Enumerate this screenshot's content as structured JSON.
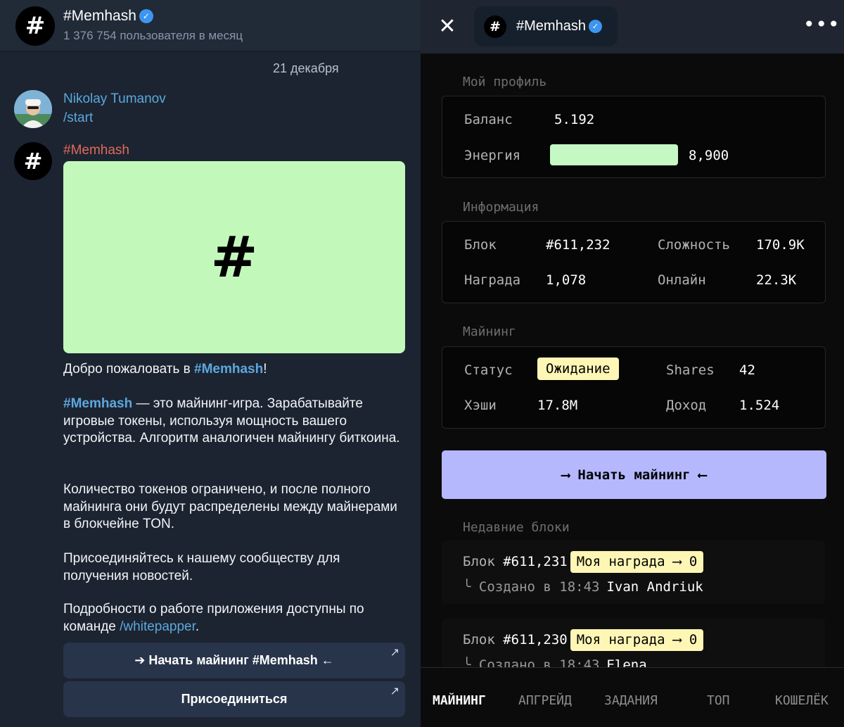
{
  "chat": {
    "title": "#Memhash",
    "subtitle": "1 376 754 пользователя в месяц",
    "date": "21 декабря",
    "user_message": {
      "name": "Nikolay Tumanov",
      "text": "/start"
    },
    "bot_message": {
      "name": "#Memhash",
      "image_glyph": "#",
      "p1_a": "Добро пожаловать в ",
      "p1_link": "#Memhash",
      "p1_b": "!",
      "p2_link": "#Memhash",
      "p2_text": " — это майнинг-игра. Зарабатывайте игровые токены, используя мощность вашего устройства. Алгоритм аналогичен майнингу биткоина.",
      "p3_text": "Количество токенов ограничено, и после полного майнинга они будут распределены между майнерами в блокчейне TON.",
      "p4_text": "Присоединяйтесь к нашему сообществу для получения новостей.",
      "p5_text": "Подробности о работе приложения доступны по команде ",
      "p5_link": "/whitepapper",
      "p5_end": "."
    },
    "buttons": {
      "start": "➔ Начать майнинг #Memhash ←",
      "join": "Присоединиться",
      "external_glyph": "↗"
    }
  },
  "app": {
    "title": "#Memhash",
    "close_glyph": "✕",
    "more_glyph": "•••",
    "verified_glyph": "✓",
    "profile": {
      "section": "Мой профиль",
      "balance_label": "Баланс",
      "balance_value": "5.192",
      "energy_label": "Энергия",
      "energy_value": "8,900",
      "energy_fraction": 1.0
    },
    "info": {
      "section": "Информация",
      "block_label": "Блок",
      "block_value": "#611,232",
      "difficulty_label": "Сложность",
      "difficulty_value": "170.9K",
      "reward_label": "Награда",
      "reward_value": "1,078",
      "online_label": "Онлайн",
      "online_value": "22.3K"
    },
    "mining": {
      "section": "Майнинг",
      "status_label": "Статус",
      "status_value": "Ожидание",
      "shares_label": "Shares",
      "shares_value": "42",
      "hashes_label": "Хэши",
      "hashes_value": "17.8M",
      "income_label": "Доход",
      "income_value": "1.524"
    },
    "start_button": "⟶ Начать майнинг ⟵",
    "recent": {
      "section": "Недавние блоки",
      "blocks": [
        {
          "label": "Блок",
          "number": "#611,231",
          "reward": "Моя награда ⟶ 0",
          "meta": "╰ Создано в 18:43",
          "by": "Ivan Andriuk"
        },
        {
          "label": "Блок",
          "number": "#611,230",
          "reward": "Моя награда ⟶ 0",
          "meta": "╰ Создано в 18:43",
          "by": "Elena"
        }
      ]
    },
    "tabs": [
      "МАЙНИНГ",
      "АПГРЕЙД",
      "ЗАДАНИЯ",
      "ТОП",
      "КОШЕЛЁК"
    ],
    "colors": {
      "energy": "#c6f8c3",
      "badge": "#fdf6b5",
      "start_button": "#b5b8fd",
      "image_bg": "#c3f8bb"
    }
  }
}
